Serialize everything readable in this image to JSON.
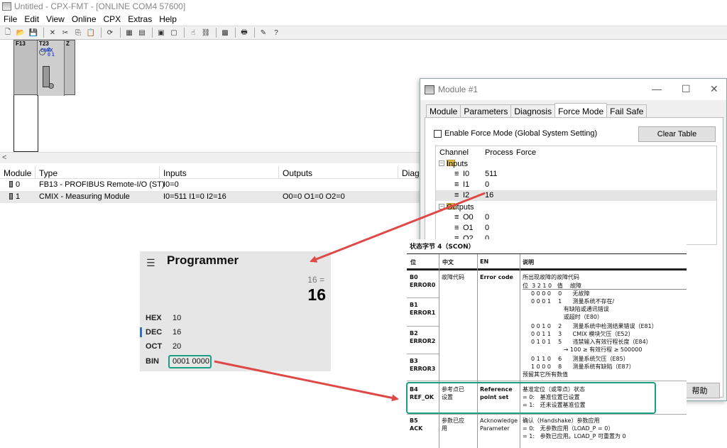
{
  "window": {
    "title": "Untitled - CPX-FMT - [ONLINE COM4 57600]"
  },
  "menu": [
    "File",
    "Edit",
    "View",
    "Online",
    "CPX",
    "Extras",
    "Help"
  ],
  "hardware": {
    "slots": [
      "F13",
      "T23",
      "CMIX",
      "Z"
    ],
    "slot_values": [
      "1",
      "2",
      "0",
      "1"
    ]
  },
  "grid": {
    "headers": [
      "Module",
      "Type",
      "Inputs",
      "Outputs",
      "Diagn"
    ],
    "rows": [
      {
        "module": "0",
        "type": "FB13 - PROFIBUS Remote-I/O (ST)",
        "inputs": "I0=0",
        "outputs": ""
      },
      {
        "module": "1",
        "type": "CMIX - Measuring Module",
        "inputs": "I0=511  I1=0  I2=16",
        "outputs": "O0=0  O1=0  O2=0"
      }
    ]
  },
  "dialog": {
    "title": "Module #1",
    "tabs": [
      "Module",
      "Parameters",
      "Diagnosis",
      "Force Mode",
      "Fail Safe"
    ],
    "active_tab": "Force Mode",
    "checkbox_label": "Enable Force Mode (Global System Setting)",
    "checkbox_checked": false,
    "clear_button": "Clear Table",
    "columns": [
      "Channel",
      "Process",
      "Force"
    ],
    "inputs_label": "Inputs",
    "outputs_label": "Outputs",
    "inputs": [
      {
        "ch": "I0",
        "val": "511"
      },
      {
        "ch": "I1",
        "val": "0"
      },
      {
        "ch": "I2",
        "val": "16"
      }
    ],
    "outputs": [
      {
        "ch": "O0",
        "val": "0"
      },
      {
        "ch": "O1",
        "val": "0"
      },
      {
        "ch": "O2",
        "val": "0"
      }
    ],
    "help_button": "帮助"
  },
  "calculator": {
    "title": "Programmer",
    "expression": "16 =",
    "result": "16",
    "bases": [
      {
        "name": "HEX",
        "value": "10"
      },
      {
        "name": "DEC",
        "value": "16"
      },
      {
        "name": "OCT",
        "value": "20"
      },
      {
        "name": "BIN",
        "value": "0001 0000"
      }
    ],
    "active_base": "DEC"
  },
  "doc": {
    "caption": "状态字节 4（SCON）",
    "headers": [
      "位",
      "中文",
      "EN",
      "说明"
    ],
    "b0": {
      "bit": [
        "B0",
        "ERROR0"
      ],
      "cn": "故障代码",
      "en": "Error code",
      "desc": "所出现故障的故障代码"
    },
    "code_header": "位  3 2 1 0   值    故障",
    "codes": [
      "0 0 0 0    0      无故障",
      "0 0 0 1    1      测量系统不存在/",
      "                  有缺陷或通讯错误",
      "                  或超时（E80）",
      "0 0 1 0    2      测量系统中检测结果错误（E81）",
      "0 0 1 1    3      CMIX 模块欠压（E52）",
      "0 1 0 1    5      违禁输入有效行程长度（E84）",
      "                  → 100 ≥ 有效行程 ≥ 500000",
      "0 1 1 0    6      测量系统欠压（E85）",
      "1 0 0 0    8      测量系统有缺陷（E87）"
    ],
    "reserved": "预留其它所有数值",
    "b1": [
      "B1",
      "ERROR1"
    ],
    "b2": [
      "B2",
      "ERROR2"
    ],
    "b3": [
      "B3",
      "ERROR3"
    ],
    "b4": {
      "bit": [
        "B4",
        "REF_OK"
      ],
      "cn": [
        "参考点已",
        "设置"
      ],
      "en": [
        "Reference",
        "point set"
      ],
      "desc": [
        "基准定位（或零点）状态",
        "= 0:   基准位置已设置",
        "= 1:   还未设置基准位置"
      ]
    },
    "b5": {
      "bit": [
        "B5",
        "ACK"
      ],
      "cn": [
        "参数已应",
        "用"
      ],
      "en": [
        "Acknowledge",
        "Parameter"
      ],
      "desc": [
        "确认（Handshake）参数应用",
        "= 0:   无参数应用（LOAD_P = 0）",
        "= 1:   参数已应用。LOAD_P 可重置为 0"
      ]
    }
  },
  "colors": {
    "arrow": "#e04848",
    "highlight": "#19a083",
    "dec_marker": "#2b70c9"
  }
}
